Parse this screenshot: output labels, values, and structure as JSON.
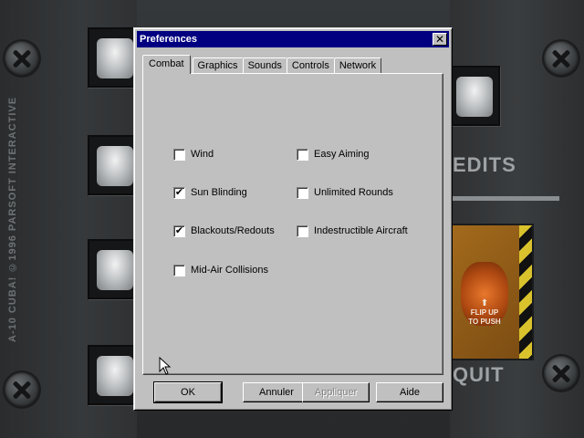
{
  "background": {
    "side_text": "A-10 CUBA! ©1996 PARSOFT INTERACTIVE",
    "credits_label": "EDITS",
    "quit_label": "QUIT",
    "quit_button_arrow": "⬆",
    "quit_button_text": [
      "FLIP UP",
      "TO PUSH"
    ]
  },
  "dialog": {
    "title": "Preferences",
    "close_glyph": "✕",
    "tabs": [
      {
        "label": "Combat",
        "active": true
      },
      {
        "label": "Graphics",
        "active": false
      },
      {
        "label": "Sounds",
        "active": false
      },
      {
        "label": "Controls",
        "active": false
      },
      {
        "label": "Network",
        "active": false
      }
    ],
    "options": [
      {
        "label": "Wind",
        "checked": false
      },
      {
        "label": "Sun Blinding",
        "checked": true
      },
      {
        "label": "Blackouts/Redouts",
        "checked": true
      },
      {
        "label": "Mid-Air Collisions",
        "checked": false
      },
      {
        "label": "Easy Aiming",
        "checked": false
      },
      {
        "label": "Unlimited Rounds",
        "checked": false
      },
      {
        "label": "Indestructible Aircraft",
        "checked": false
      }
    ],
    "check_glyph": "✔",
    "buttons": {
      "ok": "OK",
      "cancel": "Annuler",
      "apply": "Appliquer",
      "help": "Aide"
    }
  }
}
